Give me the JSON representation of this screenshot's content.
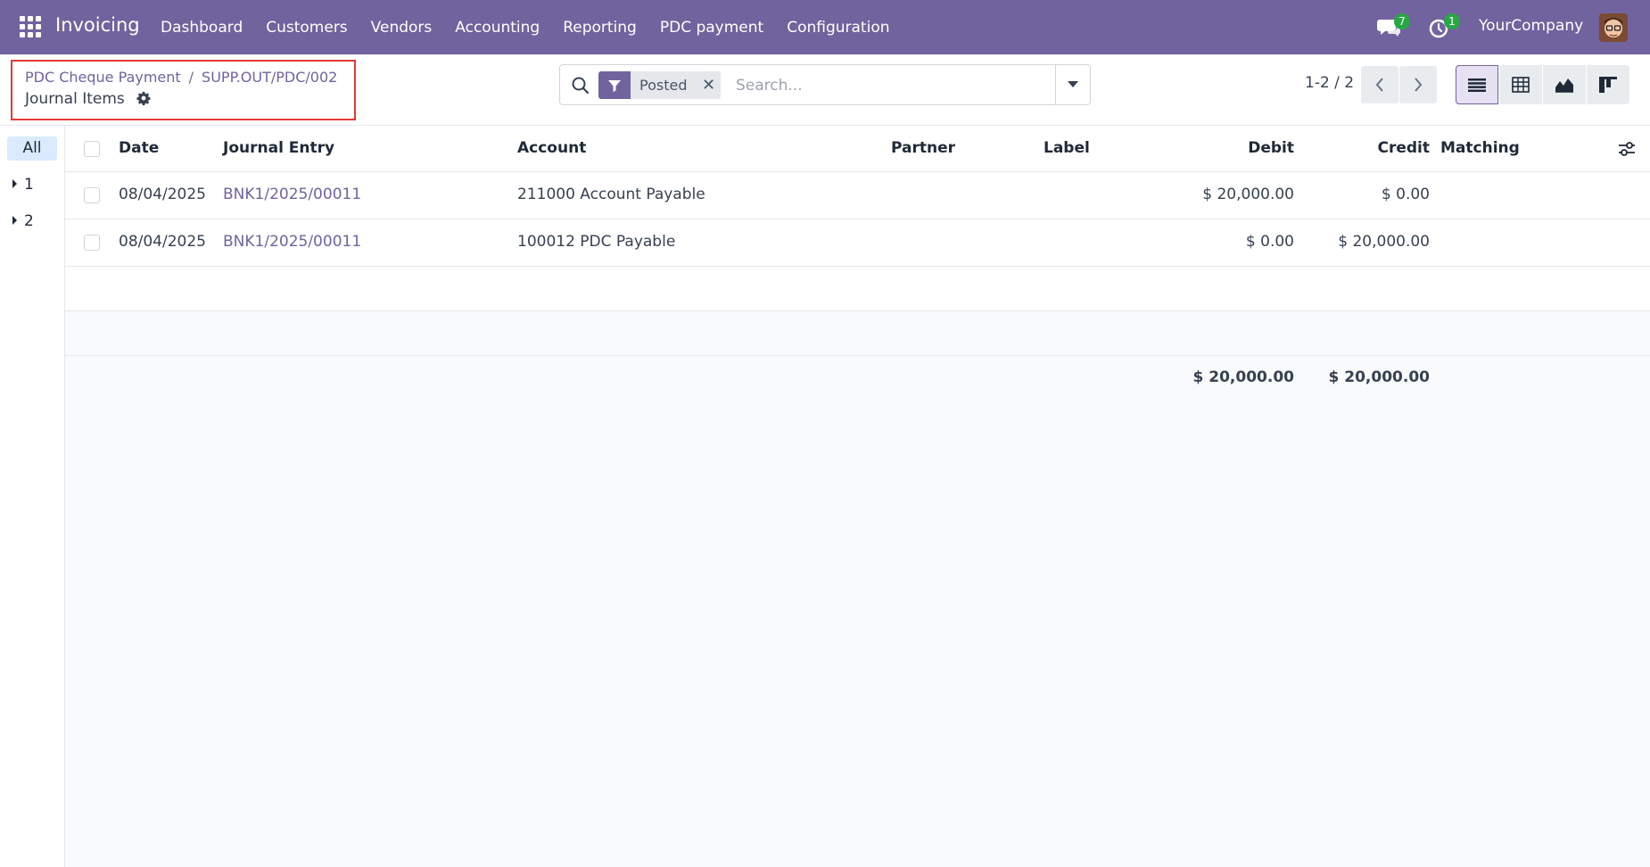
{
  "navbar": {
    "app_name": "Invoicing",
    "menu": [
      "Dashboard",
      "Customers",
      "Vendors",
      "Accounting",
      "Reporting",
      "PDC payment",
      "Configuration"
    ],
    "messages_count": "7",
    "activities_count": "1",
    "company": "YourCompany",
    "accent_color": "#71639e"
  },
  "breadcrumb": {
    "items": [
      "PDC Cheque Payment",
      "SUPP.OUT/PDC/002"
    ],
    "separator": "/",
    "current": "Journal Items"
  },
  "search": {
    "facet_label": "Posted",
    "placeholder": "Search...",
    "value": ""
  },
  "pager": {
    "value": "1-2 / 2"
  },
  "views": [
    "list",
    "pivot",
    "graph",
    "kanban"
  ],
  "sidepanel": {
    "all_label": "All",
    "groups": [
      "1",
      "2"
    ]
  },
  "table": {
    "columns": [
      "Date",
      "Journal Entry",
      "Account",
      "Partner",
      "Label",
      "Debit",
      "Credit",
      "Matching"
    ],
    "rows": [
      {
        "date": "08/04/2025",
        "entry": "BNK1/2025/00011",
        "account": "211000 Account Payable",
        "partner": "",
        "label": "",
        "debit": "$ 20,000.00",
        "credit": "$ 0.00",
        "matching": ""
      },
      {
        "date": "08/04/2025",
        "entry": "BNK1/2025/00011",
        "account": "100012 PDC Payable",
        "partner": "",
        "label": "",
        "debit": "$ 0.00",
        "credit": "$ 20,000.00",
        "matching": ""
      }
    ],
    "totals": {
      "debit": "$ 20,000.00",
      "credit": "$ 20,000.00"
    }
  }
}
